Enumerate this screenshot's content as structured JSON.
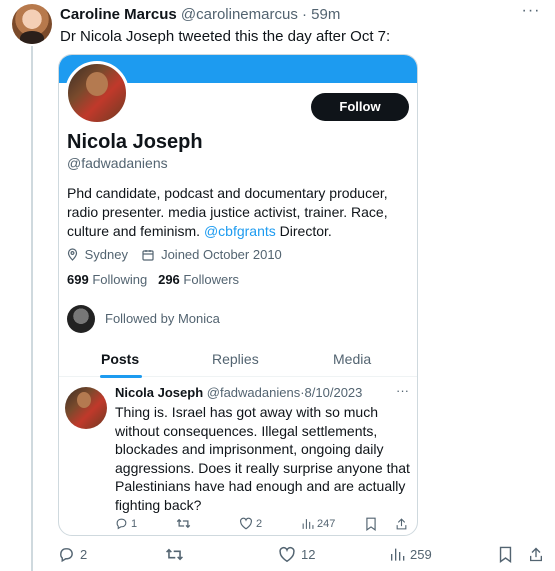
{
  "post": {
    "author_name": "Caroline Marcus",
    "author_handle": "@carolinemarcus",
    "separator": "·",
    "time": "59m",
    "more_label": "···",
    "text": "Dr Nicola Joseph tweeted this the day after Oct 7:"
  },
  "profile_card": {
    "follow_label": "Follow",
    "name": "Nicola Joseph",
    "handle": "@fadwadaniens",
    "bio_text": "Phd candidate, podcast and documentary producer, radio presenter. media justice activist, trainer. Race, culture and feminism.",
    "bio_link": "@cbfgrants",
    "bio_tail": "Director.",
    "location": "Sydney",
    "joined": "Joined October 2010",
    "following_count": "699",
    "following_label": "Following",
    "followers_count": "296",
    "followers_label": "Followers",
    "followed_by": "Followed by Monica",
    "tabs": [
      {
        "label": "Posts",
        "active": true
      },
      {
        "label": "Replies",
        "active": false
      },
      {
        "label": "Media",
        "active": false
      }
    ]
  },
  "embedded_post": {
    "author_name": "Nicola Joseph",
    "author_handle": "@fadwadaniens",
    "separator": "·",
    "date": "8/10/2023",
    "more_label": "···",
    "text": "Thing is. Israel has got away with so much without consequences. Illegal settlements, blockades and imprisonment, ongoing daily aggressions. Does it really surprise anyone that Palestinians have had enough and are actually fighting back?",
    "replies": "1",
    "reposts": "",
    "likes": "2",
    "views": "247"
  },
  "actions": {
    "replies": "2",
    "reposts": "",
    "likes": "12",
    "views": "259"
  },
  "colors": {
    "accent": "#1d9bf0",
    "text": "#0f1419",
    "muted": "#536471",
    "border": "#cfd9de"
  }
}
